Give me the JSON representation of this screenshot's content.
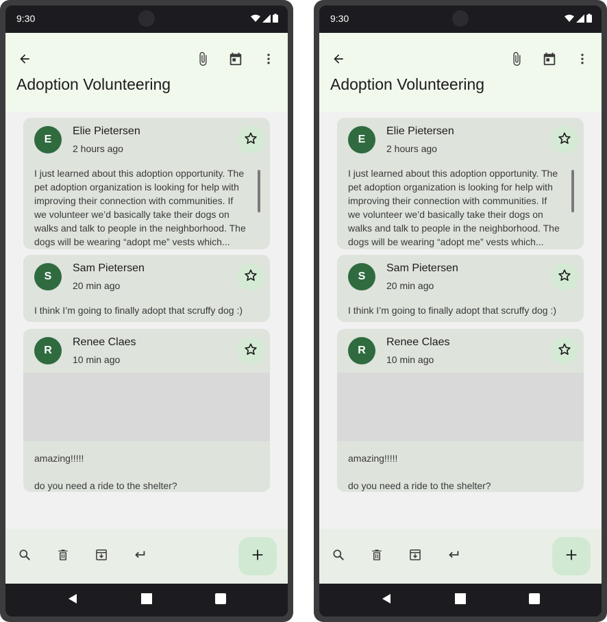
{
  "status": {
    "time": "9:30"
  },
  "header": {
    "title": "Adoption Volunteering",
    "icons": [
      "arrow-back-icon",
      "paperclip-icon",
      "calendar-icon",
      "more-vert-icon"
    ]
  },
  "messages": [
    {
      "avatar_letter": "E",
      "sender": "Elie Pietersen",
      "time": "2 hours ago",
      "body_lines": [
        "I just learned about this adoption opportunity. The",
        "pet adoption organization is looking for help with",
        "improving their connection with communities. If",
        "we volunteer we’d basically take their dogs on",
        "walks and talk to people in the neighborhood. The",
        "dogs will be wearing “adopt me” vests which..."
      ]
    },
    {
      "avatar_letter": "S",
      "sender": "Sam Pietersen",
      "time": "20 min ago",
      "body_lines": [
        "I think I’m going to finally adopt that scruffy dog :)"
      ]
    },
    {
      "avatar_letter": "R",
      "sender": "Renee Claes",
      "time": "10 min ago",
      "body_lines": [
        "amazing!!!!!",
        "",
        "do you need a ride to the shelter?"
      ]
    }
  ],
  "bottom_bar": {
    "icons": [
      "search-icon",
      "delete-icon",
      "archive-icon",
      "reply-icon"
    ],
    "fab_icon": "add-icon"
  },
  "colors": {
    "top_bar_bg": "#f1f8ec",
    "card_bg": "#dee3dc",
    "avatar_bg": "#2f6b3f",
    "fab_bg": "#d1e9d3",
    "bottom_bar_bg": "#e9efe6"
  }
}
